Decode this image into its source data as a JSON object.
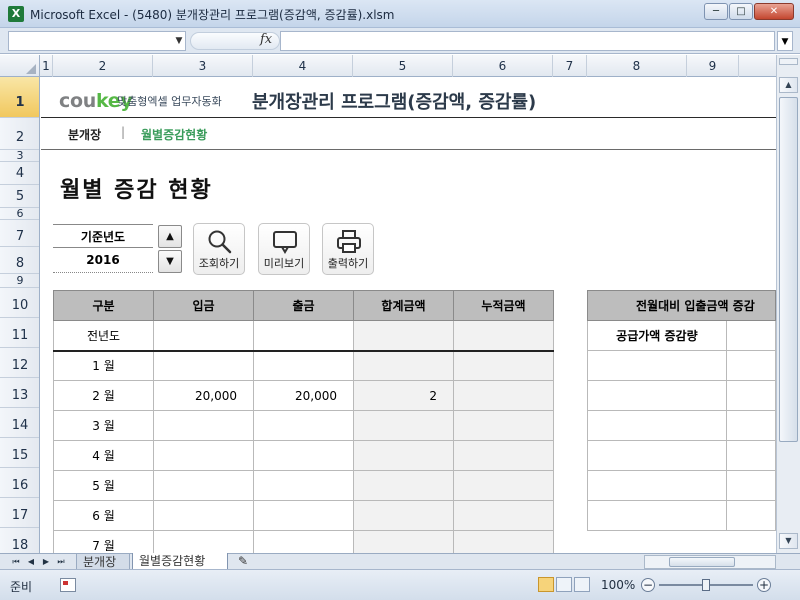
{
  "window": {
    "title": "Microsoft Excel - (5480) 분개장관리 프로그램(증감액, 증감률).xlsm",
    "app_icon": "X",
    "controls": {
      "minimize": "─",
      "maximize": "□",
      "close": "✕"
    }
  },
  "formula_bar": {
    "name_box": "",
    "fx_label": "fx",
    "formula": ""
  },
  "columns": [
    "1",
    "2",
    "3",
    "4",
    "5",
    "6",
    "7",
    "8",
    "9"
  ],
  "rows": [
    "1",
    "2",
    "3",
    "4",
    "5",
    "6",
    "7",
    "8",
    "9",
    "10",
    "11",
    "12",
    "13",
    "14",
    "15",
    "16",
    "17",
    "18"
  ],
  "sheet": {
    "logo_main": "cou",
    "logo_accent": "key",
    "logo_tagline": "맞춤형엑셀 업무자동화",
    "app_title": "분개장관리 프로그램(증감액, 증감률)",
    "nav": {
      "journal": "분개장",
      "separator": "|",
      "monthly": "월별증감현황"
    },
    "heading": "월별 증감 현황",
    "year": {
      "label": "기준년도",
      "value": "2016"
    },
    "buttons": {
      "search": "조회하기",
      "preview": "미리보기",
      "print": "출력하기"
    },
    "table": {
      "headers": [
        "구분",
        "입금",
        "출금",
        "합계금액",
        "누적금액"
      ],
      "rows": [
        {
          "label": "전년도",
          "deposit": "",
          "withdraw": "",
          "total": "",
          "cumulative": ""
        },
        {
          "label": "1 월",
          "deposit": "",
          "withdraw": "",
          "total": "",
          "cumulative": ""
        },
        {
          "label": "2 월",
          "deposit": "20,000",
          "withdraw": "20,000",
          "total": "2",
          "cumulative": ""
        },
        {
          "label": "3 월",
          "deposit": "",
          "withdraw": "",
          "total": "",
          "cumulative": ""
        },
        {
          "label": "4 월",
          "deposit": "",
          "withdraw": "",
          "total": "",
          "cumulative": ""
        },
        {
          "label": "5 월",
          "deposit": "",
          "withdraw": "",
          "total": "",
          "cumulative": ""
        },
        {
          "label": "6 월",
          "deposit": "",
          "withdraw": "",
          "total": "",
          "cumulative": ""
        },
        {
          "label": "7 월",
          "deposit": "",
          "withdraw": "",
          "total": "",
          "cumulative": ""
        }
      ]
    },
    "side_table": {
      "header": "전월대비 입출금액 증감",
      "subheader": "공급가액 증감량"
    }
  },
  "tabs": [
    "분개장",
    "월별증감현황"
  ],
  "status": {
    "text": "준비",
    "zoom": "100%"
  }
}
